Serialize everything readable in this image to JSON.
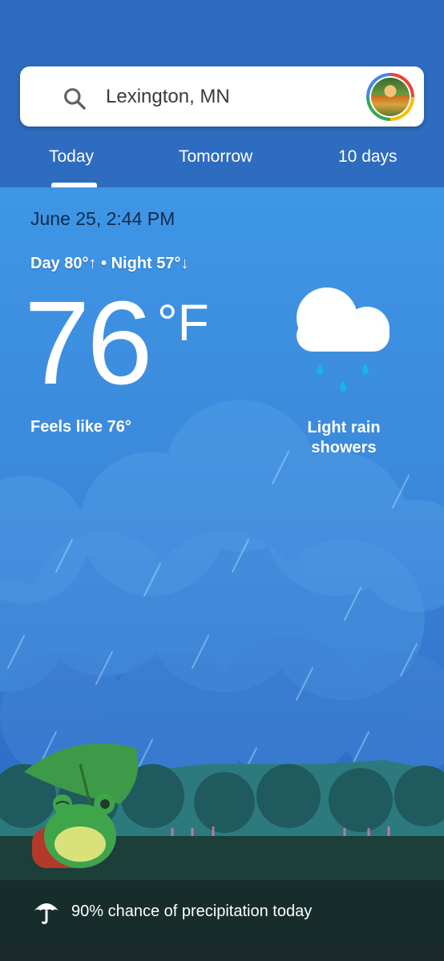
{
  "search": {
    "location": "Lexington, MN"
  },
  "tabs": [
    {
      "label": "Today"
    },
    {
      "label": "Tomorrow"
    },
    {
      "label": "10 days"
    }
  ],
  "current": {
    "datetime": "June 25, 2:44 PM",
    "day_night": "Day 80°↑ • Night 57°↓",
    "temperature": "76",
    "unit": "°F",
    "feels_like": "Feels like 76°",
    "condition_line1": "Light rain",
    "condition_line2": "showers"
  },
  "precipitation": {
    "text": "90% chance of precipitation today"
  },
  "colors": {
    "header": "#2e6cbf",
    "sky_top": "#3f96e6",
    "accent": "#1a9fe0"
  },
  "icons": {
    "search": "search-icon",
    "weather": "cloud-rain-icon",
    "precip": "umbrella-icon"
  }
}
